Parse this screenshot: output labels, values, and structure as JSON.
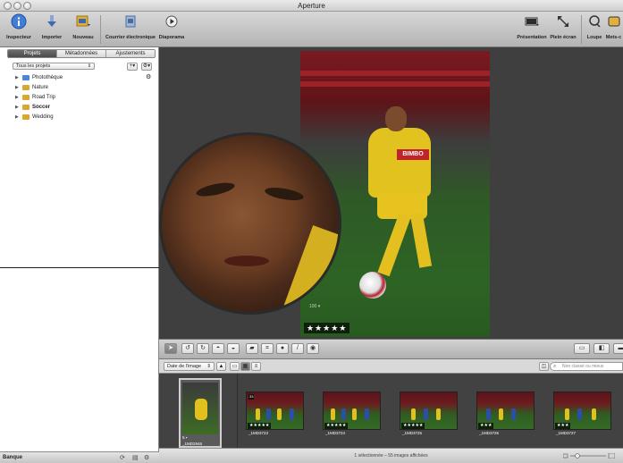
{
  "window": {
    "title": "Aperture"
  },
  "toolbar": {
    "left": [
      {
        "label": "Inspecteur",
        "icon": "info-icon"
      },
      {
        "label": "Importer",
        "icon": "import-icon"
      },
      {
        "label": "Nouveau",
        "icon": "new-project-icon"
      },
      {
        "label": "Courrier électronique",
        "icon": "email-icon"
      },
      {
        "label": "Diaporama",
        "icon": "slideshow-play-icon"
      }
    ],
    "right": [
      {
        "label": "Présentation",
        "icon": "presentation-icon"
      },
      {
        "label": "Plein écran",
        "icon": "fullscreen-icon"
      },
      {
        "label": "Loupe",
        "icon": "loupe-icon"
      },
      {
        "label": "Mets-c",
        "icon": "light-table-icon"
      }
    ]
  },
  "sidebar": {
    "tabs": [
      {
        "label": "Projets",
        "selected": true
      },
      {
        "label": "Métadonnées",
        "selected": false
      },
      {
        "label": "Ajustements",
        "selected": false
      }
    ],
    "filter": "Tous les projets",
    "items": [
      {
        "label": "Photothèque",
        "icon": "library-icon",
        "color": "#4c86d8",
        "selected": false
      },
      {
        "label": "Nature",
        "icon": "project-icon",
        "color": "#d9a832",
        "selected": false
      },
      {
        "label": "Road Trip",
        "icon": "project-icon",
        "color": "#d9a832",
        "selected": false
      },
      {
        "label": "Soccer",
        "icon": "project-icon",
        "color": "#d9a832",
        "selected": true
      },
      {
        "label": "Wedding",
        "icon": "project-icon",
        "color": "#d9a832",
        "selected": false
      }
    ],
    "footer": {
      "label": "Banque"
    }
  },
  "viewer": {
    "photo_rating": "★★★★★",
    "loupe_zoom": "100 ▾",
    "jersey_text": "BIMBO"
  },
  "browser": {
    "sort": "Date de l'image",
    "search_placeholder": "Non classé ou mieux",
    "selected_thumb": {
      "rating": "5 ▪",
      "name": "_1MD2946"
    },
    "thumbs": [
      {
        "name": "_1MD3723",
        "rating": "★★★★★",
        "badge": "33"
      },
      {
        "name": "_1MD3724",
        "rating": "★★★★★",
        "badge": ""
      },
      {
        "name": "_1MD3725",
        "rating": "★★★★★",
        "badge": ""
      },
      {
        "name": "_1MD3726",
        "rating": "★★★",
        "badge": ""
      },
      {
        "name": "_1MD3727",
        "rating": "★★★",
        "badge": ""
      }
    ],
    "status": "1 sélectionnée – 55 images affichées"
  },
  "colors": {
    "accent": "#4c86d8",
    "folder": "#d9a832",
    "viewer_bg": "#3f3f3f"
  }
}
